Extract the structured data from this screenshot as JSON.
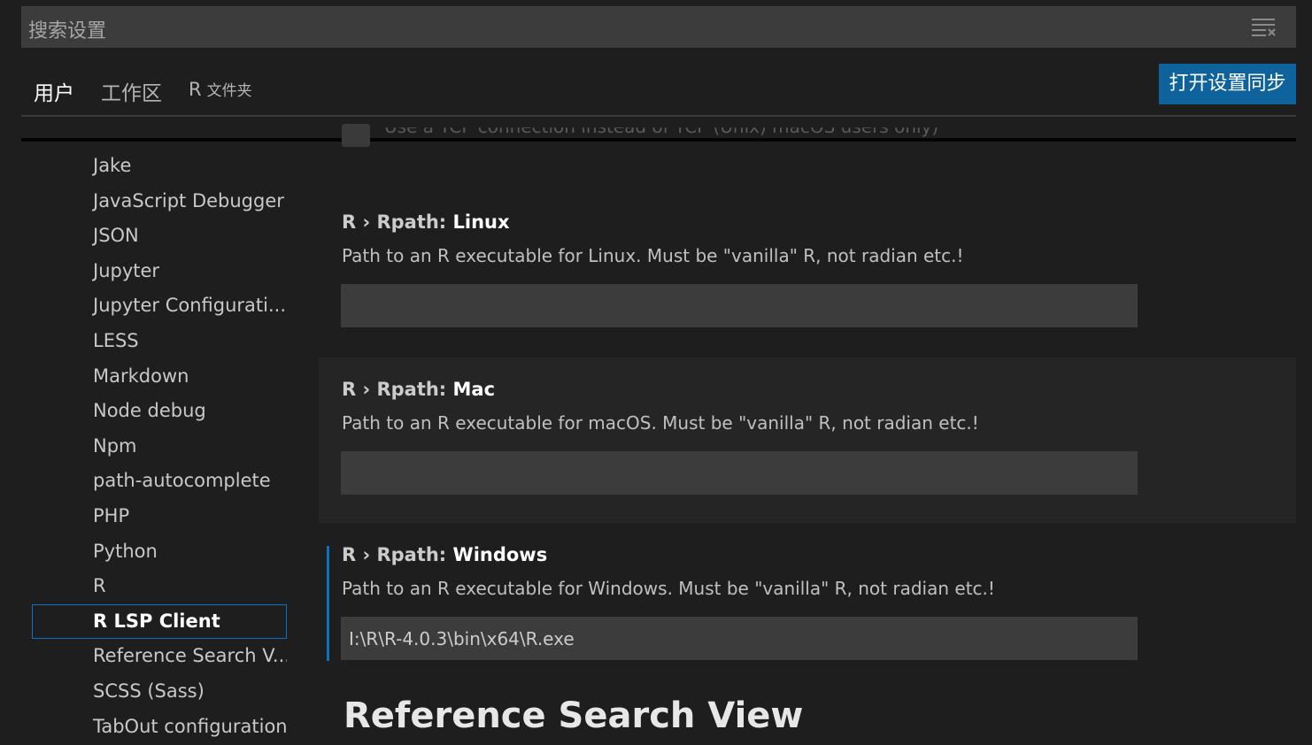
{
  "search": {
    "placeholder": "搜索设置",
    "filter_icon": "filter-list-icon"
  },
  "tabs": {
    "user": "用户",
    "workspace": "工作区",
    "folder_r": "R",
    "folder_label": "文件夹"
  },
  "sync_button": "打开设置同步",
  "toc": {
    "items": [
      "Jake",
      "JavaScript Debugger",
      "JSON",
      "Jupyter",
      "Jupyter Configurati...",
      "LESS",
      "Markdown",
      "Node debug",
      "Npm",
      "path-autocomplete",
      "PHP",
      "Python",
      "R",
      "R LSP Client",
      "Reference Search V...",
      "SCSS (Sass)",
      "TabOut configuration"
    ],
    "selected": "R LSP Client"
  },
  "partial_setting_text": "Use a TCP connection instead of TCP (Unix) macOS users only)",
  "settings": [
    {
      "category": "R › Rpath: ",
      "name": "Linux",
      "description": "Path to an R executable for Linux. Must be \"vanilla\" R, not radian etc.!",
      "value": ""
    },
    {
      "category": "R › Rpath: ",
      "name": "Mac",
      "description": "Path to an R executable for macOS. Must be \"vanilla\" R, not radian etc.!",
      "value": ""
    },
    {
      "category": "R › Rpath: ",
      "name": "Windows",
      "description": "Path to an R executable for Windows. Must be \"vanilla\" R, not radian etc.!",
      "value": "I:\\R\\R-4.0.3\\bin\\x64\\R.exe"
    }
  ],
  "next_section_heading": "Reference Search View",
  "colors": {
    "accent": "#0e639c",
    "focus": "#0e70c0",
    "background": "#1e1e1e",
    "input_background": "#3c3c3c"
  }
}
